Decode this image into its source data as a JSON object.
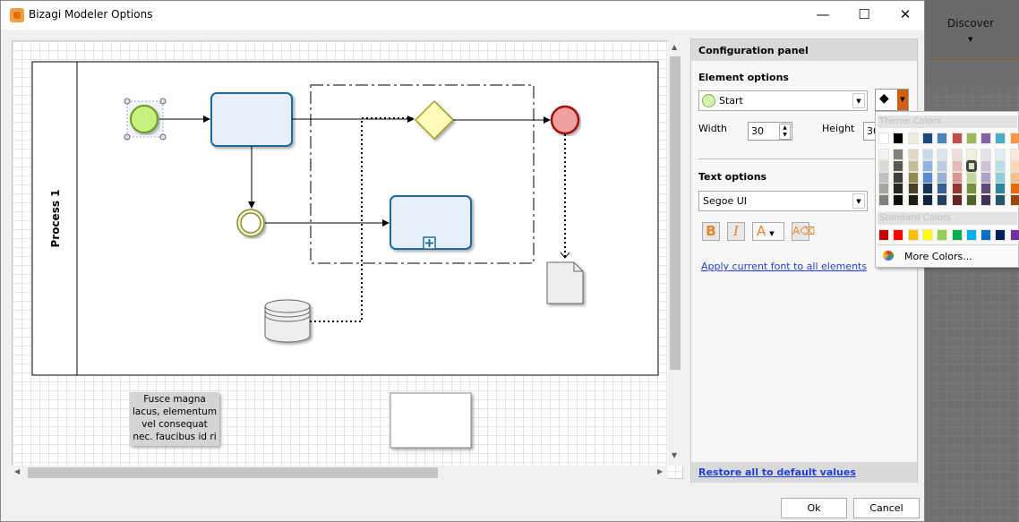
{
  "window": {
    "title": "Bizagi Modeler Options",
    "minimize": "—",
    "maximize": "☐",
    "close": "✕"
  },
  "background_app": {
    "discover_label": "Discover"
  },
  "diagram": {
    "pool_label": "Process 1",
    "annotation_lines": [
      "Fusce magna",
      "lacus, elementum",
      "vel consequat",
      "nec. faucibus id ri"
    ]
  },
  "panel": {
    "header": "Configuration panel",
    "element_options_label": "Element options",
    "element_selected": "Start",
    "width_label": "Width",
    "width_value": "30",
    "height_label": "Height",
    "height_value": "30",
    "text_options_label": "Text options",
    "font_value": "Segoe UI",
    "bold_label": "B",
    "italic_label": "I",
    "font_color_label": "A",
    "apply_font_link": "Apply current font to all elements",
    "restore_link": "Restore all to default values"
  },
  "palette": {
    "theme_header": "Theme Colors",
    "standard_header": "Standard Colors",
    "more_colors": "More Colors...",
    "theme_colors": [
      "#ffffff",
      "#000000",
      "#eeece1",
      "#1f497d",
      "#4f81bd",
      "#c0504d",
      "#9bbb59",
      "#8064a2",
      "#4bacc6",
      "#f79646"
    ],
    "shades": [
      [
        "#f2f2f2",
        "#d9d9d9",
        "#bfbfbf",
        "#a6a6a6",
        "#808080"
      ],
      [
        "#7f7f7f",
        "#595959",
        "#3f3f3f",
        "#262626",
        "#0c0c0c"
      ],
      [
        "#ddd9c3",
        "#c4bd97",
        "#938953",
        "#494429",
        "#1d1b10"
      ],
      [
        "#c6d9f0",
        "#8db3e2",
        "#548dd4",
        "#17365d",
        "#0f243e"
      ],
      [
        "#dbe5f1",
        "#b8cce4",
        "#95b3d7",
        "#366092",
        "#244061"
      ],
      [
        "#f2dcdb",
        "#e5b9b7",
        "#d99694",
        "#953734",
        "#632423"
      ],
      [
        "#ebf1dd",
        "#d7e3bc",
        "#c3d69b",
        "#76923c",
        "#4f6128"
      ],
      [
        "#e5e0ec",
        "#ccc1d9",
        "#b2a2c7",
        "#5f497a",
        "#3f3151"
      ],
      [
        "#dbeef3",
        "#b7dde8",
        "#92cddc",
        "#31859b",
        "#205867"
      ],
      [
        "#fdeada",
        "#fbd5b5",
        "#fac08f",
        "#e36c09",
        "#974806"
      ]
    ],
    "selected": "#d7e3bc",
    "standard_colors": [
      "#c00000",
      "#ff0000",
      "#ffc000",
      "#ffff00",
      "#92d050",
      "#00b050",
      "#00b0f0",
      "#0070c0",
      "#002060",
      "#7030a0"
    ]
  },
  "buttons": {
    "ok": "Ok",
    "cancel": "Cancel"
  }
}
